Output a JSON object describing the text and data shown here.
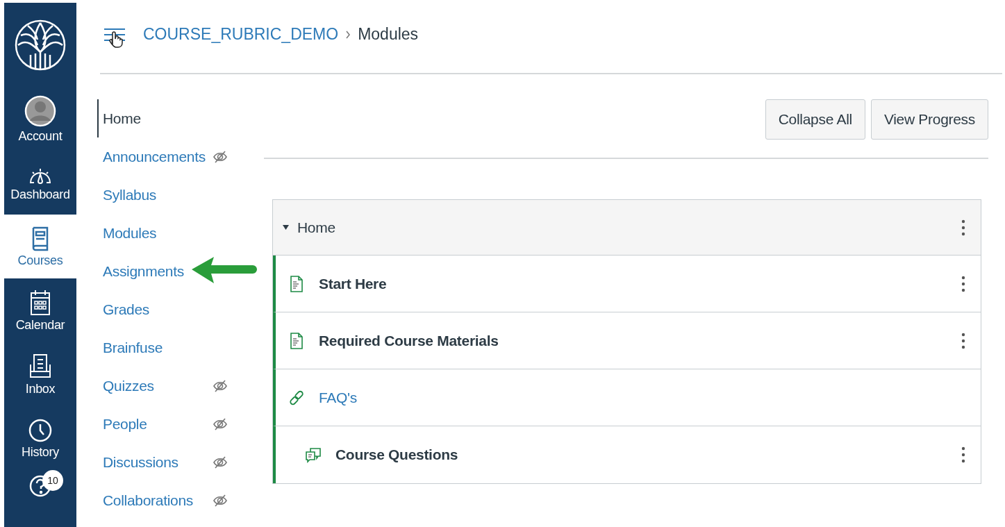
{
  "global_nav": [
    {
      "kind": "logo",
      "selected": false
    },
    {
      "kind": "account",
      "label": "Account",
      "selected": false
    },
    {
      "kind": "dashboard",
      "label": "Dashboard",
      "selected": false
    },
    {
      "kind": "courses",
      "label": "Courses",
      "selected": true
    },
    {
      "kind": "calendar",
      "label": "Calendar",
      "selected": false
    },
    {
      "kind": "inbox",
      "label": "Inbox",
      "selected": false
    },
    {
      "kind": "history",
      "label": "History",
      "selected": false
    },
    {
      "kind": "help",
      "badge": "10",
      "selected": false
    }
  ],
  "breadcrumb": [
    "COURSE_RUBRIC_DEMO",
    "Modules"
  ],
  "course_nav": [
    {
      "label": "Home",
      "selected": true,
      "hidden": false
    },
    {
      "label": "Announcements",
      "selected": false,
      "hidden": true
    },
    {
      "label": "Syllabus",
      "selected": false,
      "hidden": false
    },
    {
      "label": "Modules",
      "selected": false,
      "hidden": false
    },
    {
      "label": "Assignments",
      "selected": false,
      "hidden": false,
      "pointer": true
    },
    {
      "label": "Grades",
      "selected": false,
      "hidden": false
    },
    {
      "label": "Brainfuse",
      "selected": false,
      "hidden": false
    },
    {
      "label": "Quizzes",
      "selected": false,
      "hidden": true
    },
    {
      "label": "People",
      "selected": false,
      "hidden": true
    },
    {
      "label": "Discussions",
      "selected": false,
      "hidden": true
    },
    {
      "label": "Collaborations",
      "selected": false,
      "hidden": true
    }
  ],
  "buttons": [
    "Collapse All",
    "View Progress"
  ],
  "module": {
    "title": "Home",
    "expanded": true,
    "items": [
      {
        "kind": "page",
        "title": "Start Here",
        "indented": false,
        "menu": true
      },
      {
        "kind": "page",
        "title": "Required Course Materials",
        "indented": false,
        "menu": true
      },
      {
        "kind": "link",
        "title": "FAQ's",
        "indented": false,
        "menu": false
      },
      {
        "kind": "discussion",
        "title": "Course Questions",
        "indented": true,
        "menu": true
      }
    ]
  }
}
